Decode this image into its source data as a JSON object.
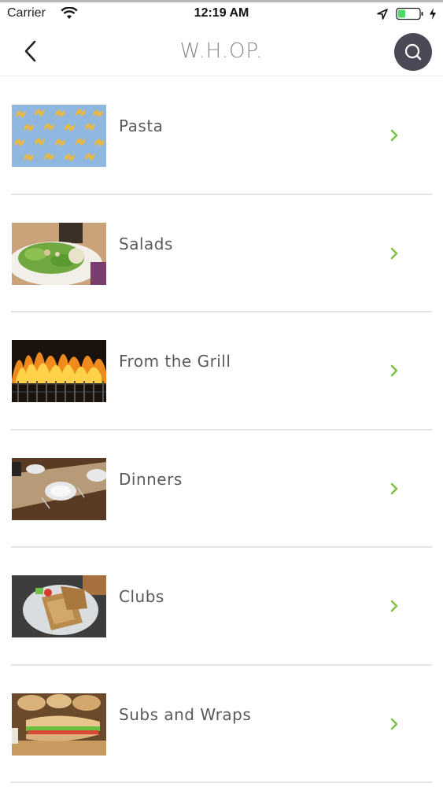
{
  "status_bar": {
    "carrier": "Carrier",
    "time": "12:19 AM"
  },
  "nav": {
    "title": "W.H.OP.",
    "back_icon": "chevron-left-icon",
    "search_icon": "search-icon"
  },
  "colors": {
    "accent_chevron": "#7cc243",
    "search_bg": "#4a4a56",
    "battery_green": "#4cd964"
  },
  "categories": [
    {
      "label": "Pasta",
      "image": "pasta-thumbnail"
    },
    {
      "label": "Salads",
      "image": "salad-thumbnail"
    },
    {
      "label": "From the Grill",
      "image": "grill-thumbnail"
    },
    {
      "label": "Dinners",
      "image": "dinner-table-thumbnail"
    },
    {
      "label": "Clubs",
      "image": "club-sandwich-thumbnail"
    },
    {
      "label": "Subs and Wraps",
      "image": "sub-sandwich-thumbnail"
    }
  ]
}
